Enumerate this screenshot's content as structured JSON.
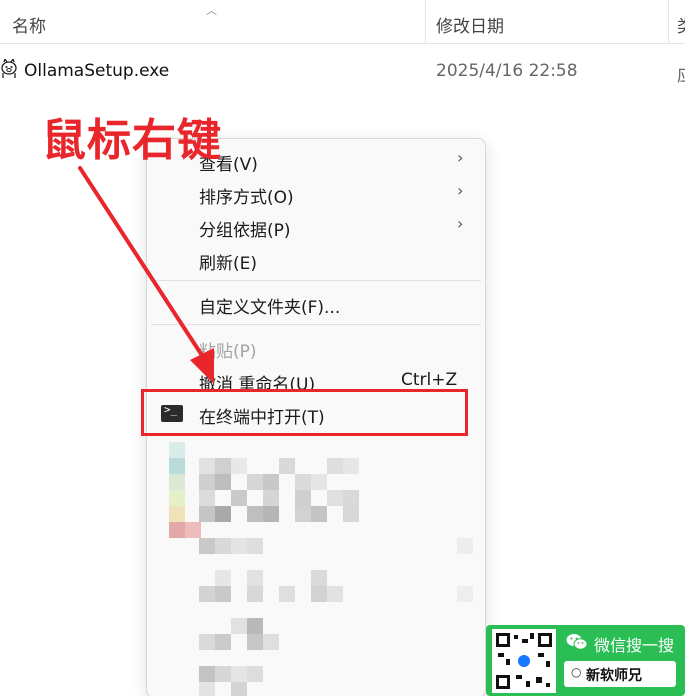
{
  "header": {
    "col_name": "名称",
    "col_date": "修改日期",
    "col_type": "类"
  },
  "file": {
    "name": "OllamaSetup.exe",
    "date": "2025/4/16 22:58",
    "type": "应"
  },
  "annotation": {
    "text": "鼠标右键",
    "color": "#e8262c"
  },
  "menu": {
    "items": [
      {
        "label": "查看(V)",
        "submenu": true
      },
      {
        "label": "排序方式(O)",
        "submenu": true
      },
      {
        "label": "分组依据(P)",
        "submenu": true
      },
      {
        "label": "刷新(E)",
        "submenu": false
      },
      {
        "label": "自定义文件夹(F)...",
        "submenu": false
      },
      {
        "label": "粘贴(P)",
        "disabled": true
      },
      {
        "label": "撤消 重命名(U)",
        "accelerator": "Ctrl+Z"
      },
      {
        "label": "在终端中打开(T)",
        "icon": "terminal-icon",
        "highlighted": true
      }
    ]
  },
  "badge": {
    "wechat_text": "微信搜一搜",
    "search_text": "新软师兄",
    "color": "#2bbe55"
  }
}
